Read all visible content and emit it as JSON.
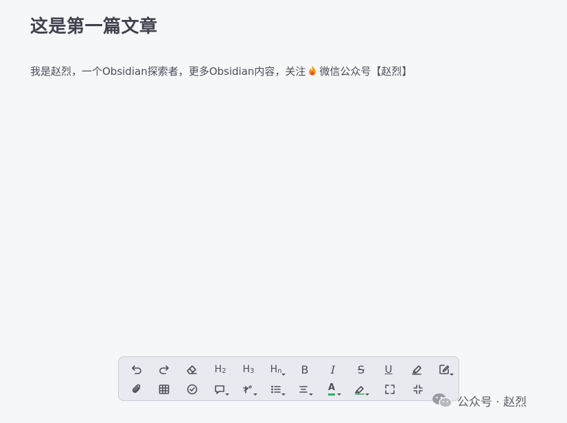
{
  "document": {
    "title": "这是第一篇文章",
    "paragraph_before": "我是赵烈，一个Obsidian探索者，更多Obsidian内容，关注",
    "paragraph_after": "微信公众号【赵烈】",
    "emoji_icon": "fire-icon"
  },
  "toolbar": {
    "row1": [
      {
        "name": "undo",
        "icon": "undo-icon"
      },
      {
        "name": "redo",
        "icon": "redo-icon"
      },
      {
        "name": "clear-format",
        "icon": "eraser-icon"
      },
      {
        "name": "heading-2",
        "label": "H",
        "sub": "2"
      },
      {
        "name": "heading-3",
        "label": "H",
        "sub": "3"
      },
      {
        "name": "heading-n",
        "label": "H",
        "sub": "n"
      },
      {
        "name": "bold",
        "label": "B"
      },
      {
        "name": "italic",
        "label": "I"
      },
      {
        "name": "strikethrough",
        "label": "S"
      },
      {
        "name": "underline",
        "label": "U"
      },
      {
        "name": "highlight-pen",
        "icon": "pen-icon"
      },
      {
        "name": "edit-note",
        "icon": "edit-icon"
      }
    ],
    "row2": [
      {
        "name": "attachment",
        "icon": "paperclip-icon"
      },
      {
        "name": "table",
        "icon": "table-icon"
      },
      {
        "name": "task-check",
        "icon": "check-circle-icon"
      },
      {
        "name": "comment",
        "icon": "comment-icon"
      },
      {
        "name": "ruby-annotation",
        "icon": "ruby-icon"
      },
      {
        "name": "list",
        "icon": "list-icon"
      },
      {
        "name": "align",
        "icon": "align-icon"
      },
      {
        "name": "text-color",
        "label": "A",
        "accent": "#27ae60"
      },
      {
        "name": "highlight-color",
        "icon": "highlighter-icon"
      },
      {
        "name": "fullscreen",
        "icon": "expand-icon"
      },
      {
        "name": "exit-fullscreen",
        "icon": "collapse-icon"
      }
    ]
  },
  "watermark": {
    "icon": "wechat-icon",
    "text": "公众号 · 赵烈"
  },
  "colors": {
    "background": "#f6f7f9",
    "toolbar_bg": "#e9eaef",
    "text_color_accent": "#27ae60",
    "flame_outer": "#f39c12",
    "flame_inner": "#e74c3c"
  }
}
